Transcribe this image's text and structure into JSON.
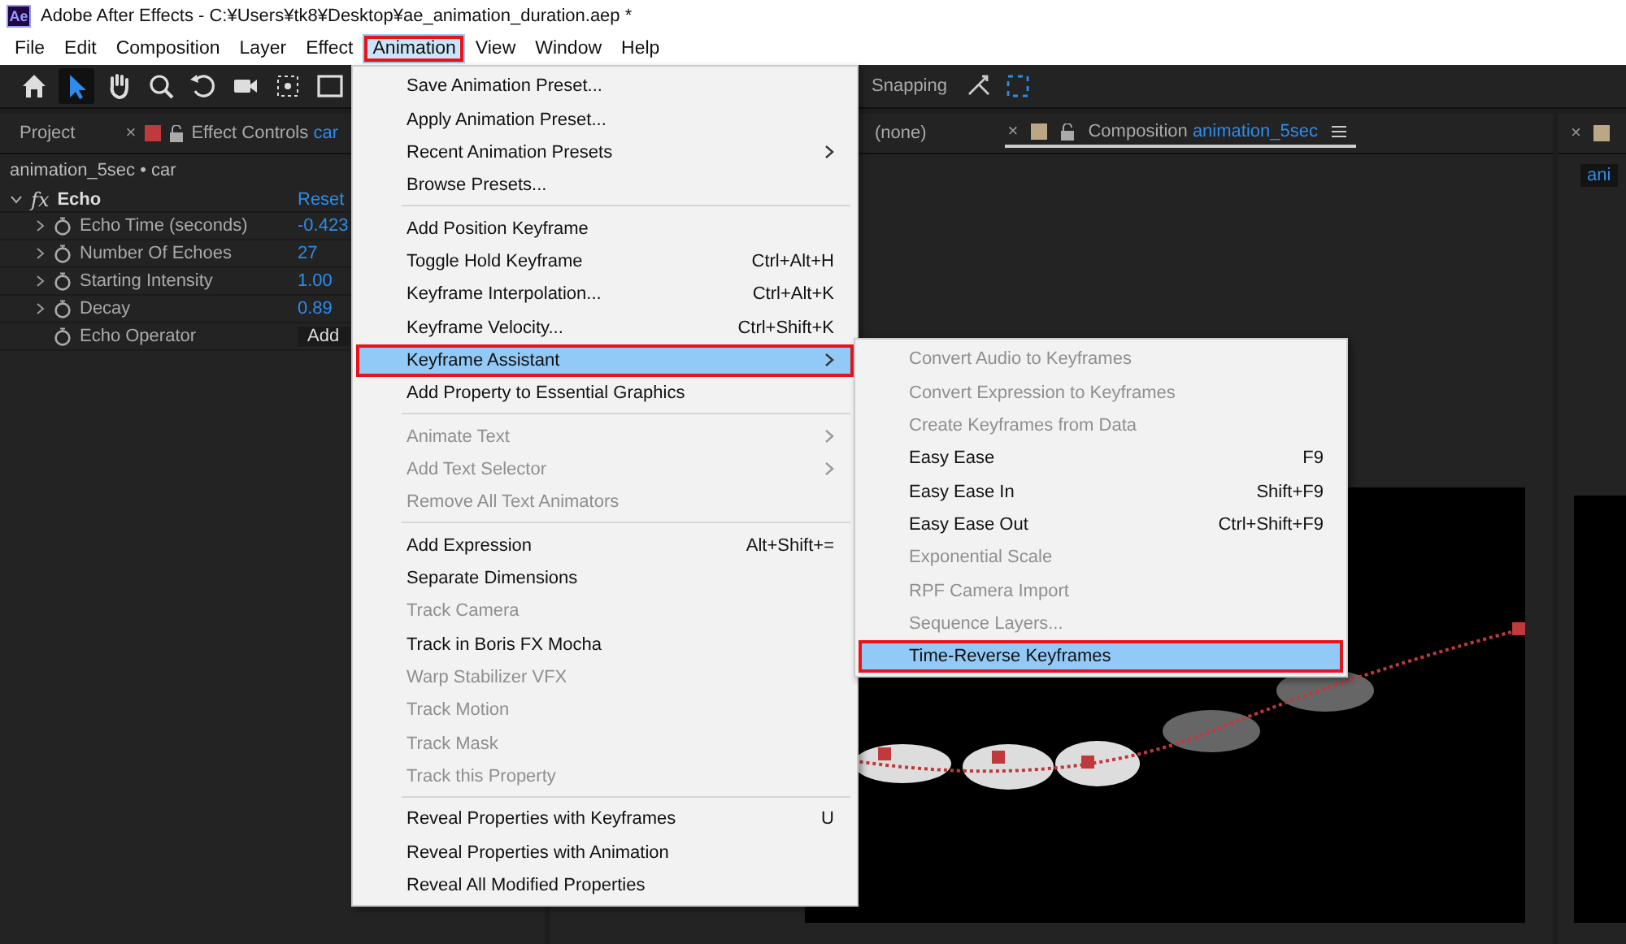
{
  "window": {
    "app_icon": "Ae",
    "title": "Adobe After Effects - C:¥Users¥tk8¥Desktop¥ae_animation_duration.aep *"
  },
  "menu_bar": [
    {
      "label": "File",
      "selected": false,
      "annotated": false
    },
    {
      "label": "Edit",
      "selected": false,
      "annotated": false
    },
    {
      "label": "Composition",
      "selected": false,
      "annotated": false
    },
    {
      "label": "Layer",
      "selected": false,
      "annotated": false
    },
    {
      "label": "Effect",
      "selected": false,
      "annotated": false
    },
    {
      "label": "Animation",
      "selected": true,
      "annotated": true
    },
    {
      "label": "View",
      "selected": false,
      "annotated": false
    },
    {
      "label": "Window",
      "selected": false,
      "annotated": false
    },
    {
      "label": "Help",
      "selected": false,
      "annotated": false
    }
  ],
  "toolbar": {
    "tools": [
      {
        "kind": "home",
        "selected": false
      },
      {
        "kind": "select",
        "selected": true
      },
      {
        "kind": "hand",
        "selected": false
      },
      {
        "kind": "zoom",
        "selected": false
      },
      {
        "kind": "rotate",
        "selected": false
      },
      {
        "kind": "camera",
        "selected": false
      },
      {
        "kind": "pan-behind",
        "selected": false
      },
      {
        "kind": "shape",
        "selected": false
      }
    ],
    "snapping": {
      "label": "Snapping"
    }
  },
  "effect_controls_panel": {
    "project_tab": "Project",
    "close": "×",
    "tab": {
      "label": "Effect Controls",
      "layer": "car"
    },
    "breadcrumb": "animation_5sec • car",
    "effect": {
      "badge": "fx",
      "name": "Echo",
      "reset": "Reset",
      "expanded": true,
      "properties": [
        {
          "name": "Echo Time (seconds)",
          "value": "-0.423",
          "kind": "number"
        },
        {
          "name": "Number Of Echoes",
          "value": "27",
          "kind": "number"
        },
        {
          "name": "Starting Intensity",
          "value": "1.00",
          "kind": "number"
        },
        {
          "name": "Decay",
          "value": "0.89",
          "kind": "number"
        },
        {
          "name": "Echo Operator",
          "value": "Add",
          "kind": "dropdown"
        }
      ]
    }
  },
  "layer_panel": {
    "label": "(none)"
  },
  "composition_panel": {
    "tab": {
      "close": "×",
      "label": "Composition",
      "name": "animation_5sec"
    }
  },
  "right_panel": {
    "close": "×",
    "field": "ani"
  },
  "menu": {
    "items": [
      {
        "kind": "item",
        "label": "Save Animation Preset...",
        "disabled": false,
        "submenu": false,
        "selected": false,
        "annotated": false
      },
      {
        "kind": "item",
        "label": "Apply Animation Preset...",
        "disabled": false,
        "submenu": false,
        "selected": false,
        "annotated": false
      },
      {
        "kind": "item",
        "label": "Recent Animation Presets",
        "disabled": false,
        "submenu": true,
        "selected": false,
        "annotated": false
      },
      {
        "kind": "item",
        "label": "Browse Presets...",
        "disabled": false,
        "submenu": false,
        "selected": false,
        "annotated": false
      },
      {
        "kind": "separator"
      },
      {
        "kind": "item",
        "label": "Add Position Keyframe",
        "disabled": false,
        "submenu": false,
        "selected": false,
        "annotated": false
      },
      {
        "kind": "item",
        "label": "Toggle Hold Keyframe",
        "shortcut": "Ctrl+Alt+H",
        "disabled": false,
        "submenu": false,
        "selected": false,
        "annotated": false
      },
      {
        "kind": "item",
        "label": "Keyframe Interpolation...",
        "shortcut": "Ctrl+Alt+K",
        "disabled": false,
        "submenu": false,
        "selected": false,
        "annotated": false
      },
      {
        "kind": "item",
        "label": "Keyframe Velocity...",
        "shortcut": "Ctrl+Shift+K",
        "disabled": false,
        "submenu": false,
        "selected": false,
        "annotated": false
      },
      {
        "kind": "item",
        "label": "Keyframe Assistant",
        "disabled": false,
        "submenu": true,
        "selected": true,
        "annotated": true
      },
      {
        "kind": "item",
        "label": "Add Property to Essential Graphics",
        "disabled": false,
        "submenu": false,
        "selected": false,
        "annotated": false
      },
      {
        "kind": "separator"
      },
      {
        "kind": "item",
        "label": "Animate Text",
        "disabled": true,
        "submenu": true,
        "selected": false,
        "annotated": false
      },
      {
        "kind": "item",
        "label": "Add Text Selector",
        "disabled": true,
        "submenu": true,
        "selected": false,
        "annotated": false
      },
      {
        "kind": "item",
        "label": "Remove All Text Animators",
        "disabled": true,
        "submenu": false,
        "selected": false,
        "annotated": false
      },
      {
        "kind": "separator"
      },
      {
        "kind": "item",
        "label": "Add Expression",
        "shortcut": "Alt+Shift+=",
        "disabled": false,
        "submenu": false,
        "selected": false,
        "annotated": false
      },
      {
        "kind": "item",
        "label": "Separate Dimensions",
        "disabled": false,
        "submenu": false,
        "selected": false,
        "annotated": false
      },
      {
        "kind": "item",
        "label": "Track Camera",
        "disabled": true,
        "submenu": false,
        "selected": false,
        "annotated": false
      },
      {
        "kind": "item",
        "label": "Track in Boris FX Mocha",
        "disabled": false,
        "submenu": false,
        "selected": false,
        "annotated": false
      },
      {
        "kind": "item",
        "label": "Warp Stabilizer VFX",
        "disabled": true,
        "submenu": false,
        "selected": false,
        "annotated": false
      },
      {
        "kind": "item",
        "label": "Track Motion",
        "disabled": true,
        "submenu": false,
        "selected": false,
        "annotated": false
      },
      {
        "kind": "item",
        "label": "Track Mask",
        "disabled": true,
        "submenu": false,
        "selected": false,
        "annotated": false
      },
      {
        "kind": "item",
        "label": "Track this Property",
        "disabled": true,
        "submenu": false,
        "selected": false,
        "annotated": false
      },
      {
        "kind": "separator"
      },
      {
        "kind": "item",
        "label": "Reveal Properties with Keyframes",
        "shortcut": "U",
        "disabled": false,
        "submenu": false,
        "selected": false,
        "annotated": false
      },
      {
        "kind": "item",
        "label": "Reveal Properties with Animation",
        "disabled": false,
        "submenu": false,
        "selected": false,
        "annotated": false
      },
      {
        "kind": "item",
        "label": "Reveal All Modified Properties",
        "disabled": false,
        "submenu": false,
        "selected": false,
        "annotated": false
      }
    ]
  },
  "submenu": {
    "items": [
      {
        "kind": "item",
        "label": "Convert Audio to Keyframes",
        "disabled": true,
        "submenu": false,
        "selected": false,
        "annotated": false
      },
      {
        "kind": "item",
        "label": "Convert Expression to Keyframes",
        "disabled": true,
        "submenu": false,
        "selected": false,
        "annotated": false
      },
      {
        "kind": "item",
        "label": "Create Keyframes from Data",
        "disabled": true,
        "submenu": false,
        "selected": false,
        "annotated": false
      },
      {
        "kind": "item",
        "label": "Easy Ease",
        "shortcut": "F9",
        "disabled": false,
        "submenu": false,
        "selected": false,
        "annotated": false
      },
      {
        "kind": "item",
        "label": "Easy Ease In",
        "shortcut": "Shift+F9",
        "disabled": false,
        "submenu": false,
        "selected": false,
        "annotated": false
      },
      {
        "kind": "item",
        "label": "Easy Ease Out",
        "shortcut": "Ctrl+Shift+F9",
        "disabled": false,
        "submenu": false,
        "selected": false,
        "annotated": false
      },
      {
        "kind": "item",
        "label": "Exponential Scale",
        "disabled": true,
        "submenu": false,
        "selected": false,
        "annotated": false
      },
      {
        "kind": "item",
        "label": "RPF Camera Import",
        "disabled": true,
        "submenu": false,
        "selected": false,
        "annotated": false
      },
      {
        "kind": "item",
        "label": "Sequence Layers...",
        "disabled": true,
        "submenu": false,
        "selected": false,
        "annotated": false
      },
      {
        "kind": "item",
        "label": "Time-Reverse Keyframes",
        "disabled": false,
        "submenu": false,
        "selected": true,
        "annotated": true
      }
    ]
  }
}
